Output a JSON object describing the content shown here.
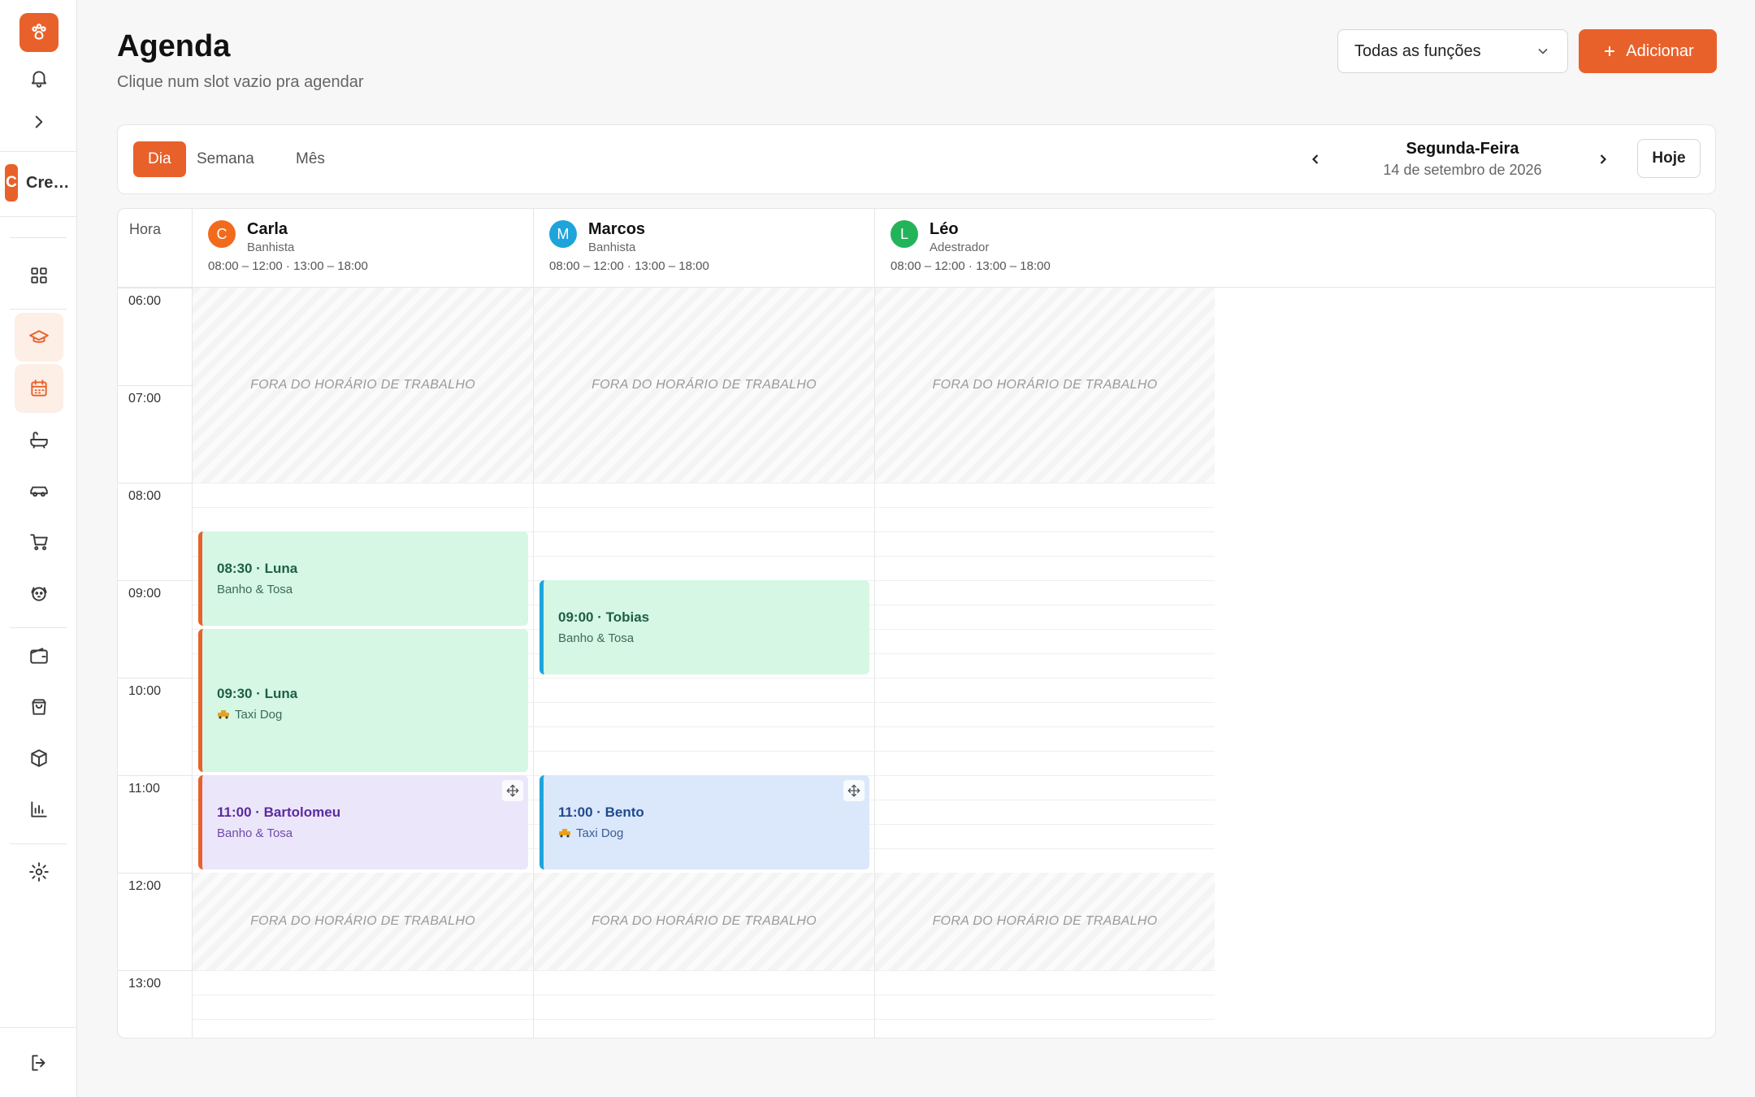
{
  "sidebar": {
    "company_initial": "C",
    "company_name": "Cre…"
  },
  "header": {
    "title": "Agenda",
    "subtitle": "Clique num slot vazio pra agendar",
    "role_filter": "Todas as funções",
    "add_label": "Adicionar"
  },
  "toolbar": {
    "views": [
      "Dia",
      "Semana",
      "Mês"
    ],
    "active_view": "Dia",
    "day_name": "Segunda-Feira",
    "date": "14 de setembro de 2026",
    "today_label": "Hoje"
  },
  "calendar": {
    "time_column_label": "Hora",
    "hours": [
      "06:00",
      "07:00",
      "08:00",
      "09:00",
      "10:00",
      "11:00",
      "12:00",
      "13:00"
    ],
    "off_hours_label": "FORA DO HORÁRIO DE TRABALHO",
    "staff": [
      {
        "initial": "C",
        "name": "Carla",
        "role": "Banhista",
        "hours": "08:00 – 12:00 · 13:00 – 18:00",
        "color": "#f26b1d"
      },
      {
        "initial": "M",
        "name": "Marcos",
        "role": "Banhista",
        "hours": "08:00 – 12:00 · 13:00 – 18:00",
        "color": "#1ea4db"
      },
      {
        "initial": "L",
        "name": "Léo",
        "role": "Adestrador",
        "hours": "08:00 – 12:00 · 13:00 – 18:00",
        "color": "#23b45a"
      }
    ],
    "appointments": [
      {
        "title": "08:30 · Luna",
        "service": "Banho & Tosa"
      },
      {
        "title": "09:30 · Luna",
        "service": "Taxi Dog"
      },
      {
        "title": "11:00 · Bartolomeu",
        "service": "Banho & Tosa"
      },
      {
        "title": "09:00 · Tobias",
        "service": "Banho & Tosa"
      },
      {
        "title": "11:00 · Bento",
        "service": "Taxi Dog"
      }
    ]
  }
}
